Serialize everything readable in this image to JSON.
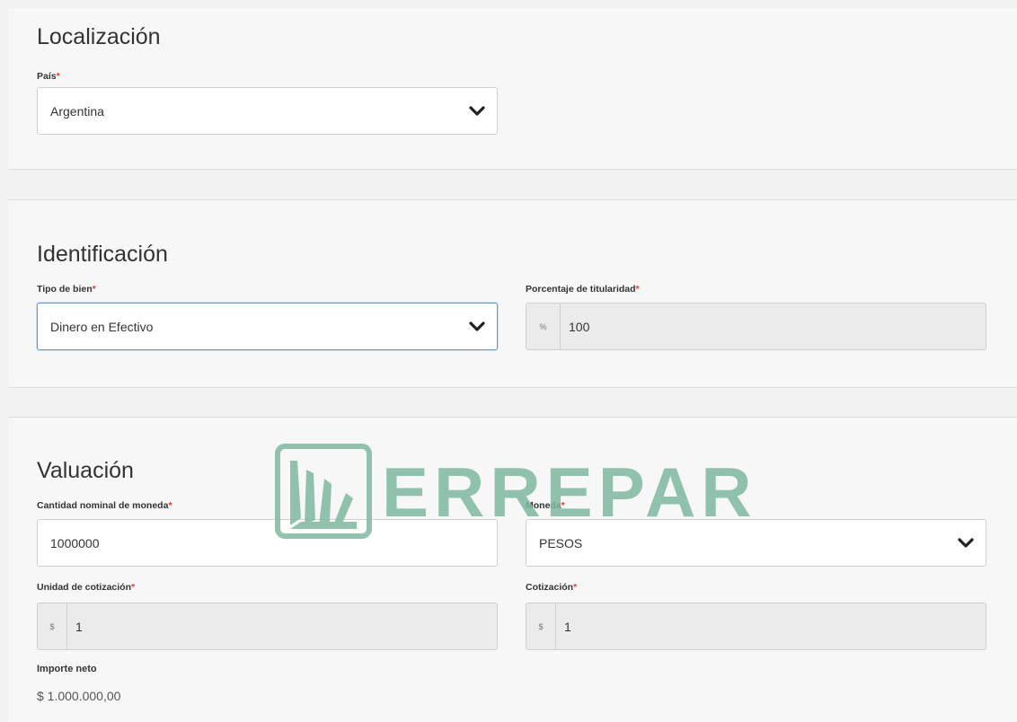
{
  "localizacion": {
    "title": "Localización",
    "pais_label": "País",
    "required_mark": "*",
    "pais_value": "Argentina"
  },
  "identificacion": {
    "title": "Identificación",
    "tipo_label": "Tipo de bien",
    "tipo_value": "Dinero en Efectivo",
    "porcentaje_label": "Porcentaje de titularidad",
    "porcentaje_addon": "%",
    "porcentaje_value": "100"
  },
  "valuacion": {
    "title": "Valuación",
    "cantidad_label": "Cantidad nominal de moneda",
    "cantidad_value": "1000000",
    "moneda_label": "Moneda",
    "moneda_value": "PESOS",
    "unidad_label": "Unidad de cotización",
    "unidad_addon": "$",
    "unidad_value": "1",
    "cotizacion_label": "Cotización",
    "cotizacion_addon": "$",
    "cotizacion_value": "1",
    "importe_label": "Importe neto",
    "importe_value": "$ 1.000.000,00"
  },
  "watermark": {
    "text": "ERREPAR",
    "color": "#7fb8a0"
  },
  "colors": {
    "required": "#e53935",
    "focus": "#5b9bd5"
  },
  "icons": {
    "select": "chevron-down-icon",
    "logo": "errepar-logo"
  }
}
